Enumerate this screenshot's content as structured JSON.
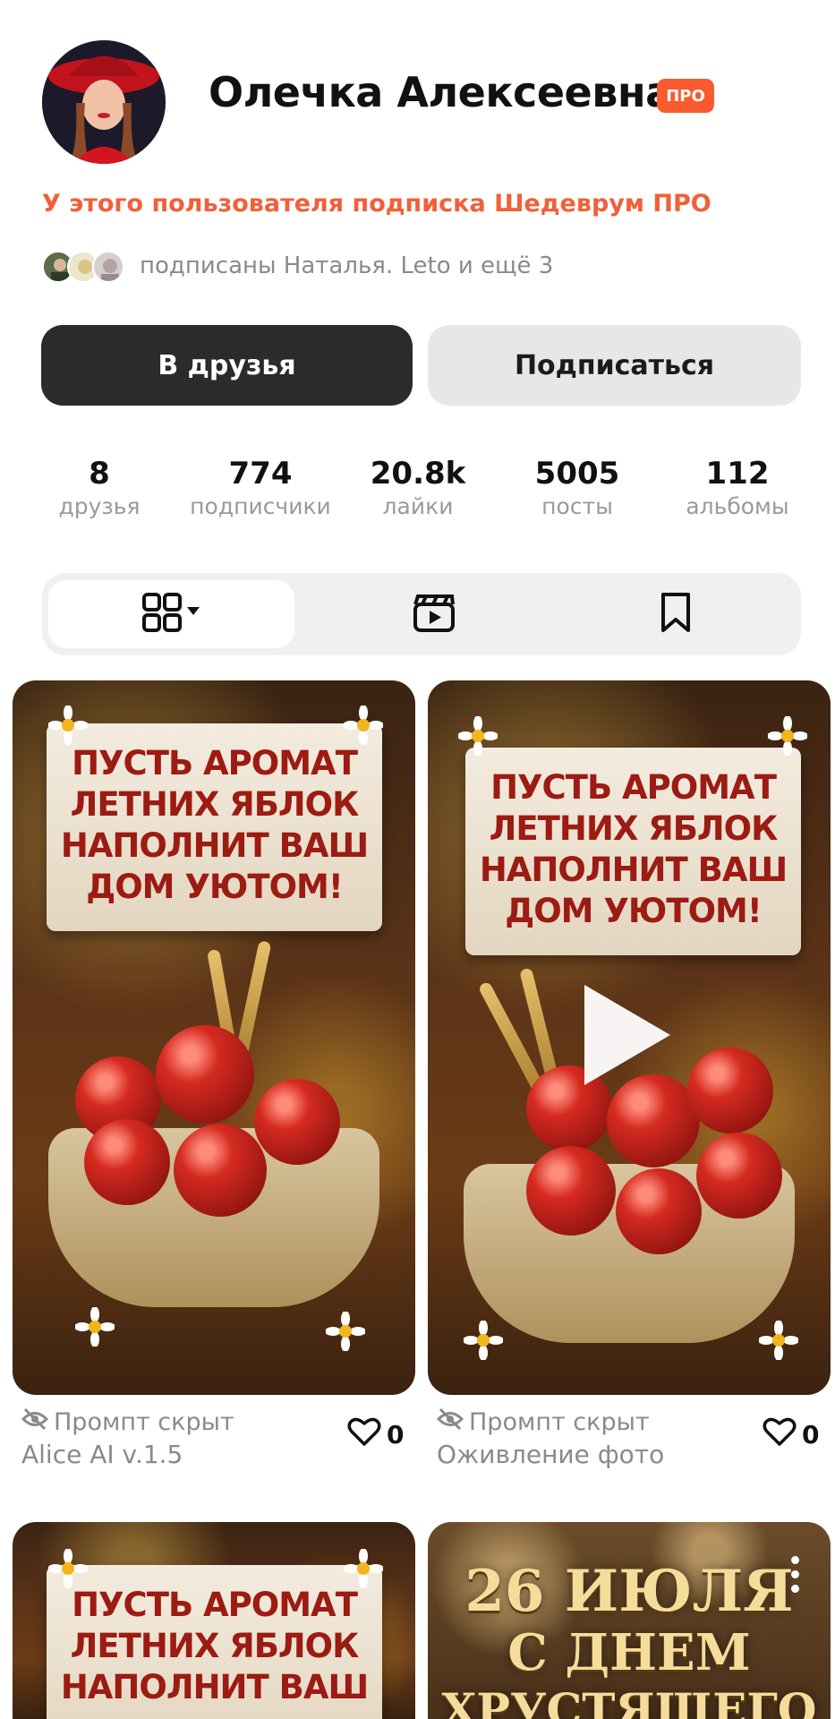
{
  "profile": {
    "name": "Олечка Алексеевна",
    "badge": "ПРО",
    "subscription_notice": "У этого пользователя подписка Шедеврум ПРО",
    "followed_by": "подписаны Наталья. Leto и ещё 3"
  },
  "actions": {
    "friends_label": "В друзья",
    "subscribe_label": "Подписаться"
  },
  "stats": [
    {
      "value": "8",
      "label": "друзья"
    },
    {
      "value": "774",
      "label": "подписчики"
    },
    {
      "value": "20.8k",
      "label": "лайки"
    },
    {
      "value": "5005",
      "label": "посты"
    },
    {
      "value": "112",
      "label": "альбомы"
    }
  ],
  "tabs": [
    {
      "icon": "grid-icon",
      "active": true
    },
    {
      "icon": "clapperboard-icon",
      "active": false
    },
    {
      "icon": "bookmark-icon",
      "active": false
    }
  ],
  "posts": [
    {
      "image_text": [
        "ПУСТЬ АРОМАТ",
        "ЛЕТНИХ ЯБЛОК",
        "НАПОЛНИТ ВАШ",
        "ДОМ УЮТОМ!"
      ],
      "prompt_status": "Промпт скрыт",
      "model": "Alice AI v.1.5",
      "likes": "0",
      "is_video": false
    },
    {
      "image_text": [
        "ПУСТЬ АРОМАТ",
        "ЛЕТНИХ ЯБЛОК",
        "НАПОЛНИТ ВАШ",
        "ДОМ УЮТОМ!"
      ],
      "prompt_status": "Промпт скрыт",
      "model": "Оживление фото",
      "likes": "0",
      "is_video": true
    },
    {
      "image_text": [
        "ПУСТЬ АРОМАТ",
        "ЛЕТНИХ ЯБЛОК",
        "НАПОЛНИТ ВАШ"
      ],
      "is_video": false
    },
    {
      "image_text": [
        "26 ИЮЛЯ",
        "С ДНЕМ",
        "ХРУСТЯЩЕГО"
      ],
      "is_video": false
    }
  ],
  "colors": {
    "accent": "#fa5b2e",
    "notice": "#f0603a",
    "primary_button": "#2b2b2b",
    "secondary_button": "#e7e7e7"
  }
}
